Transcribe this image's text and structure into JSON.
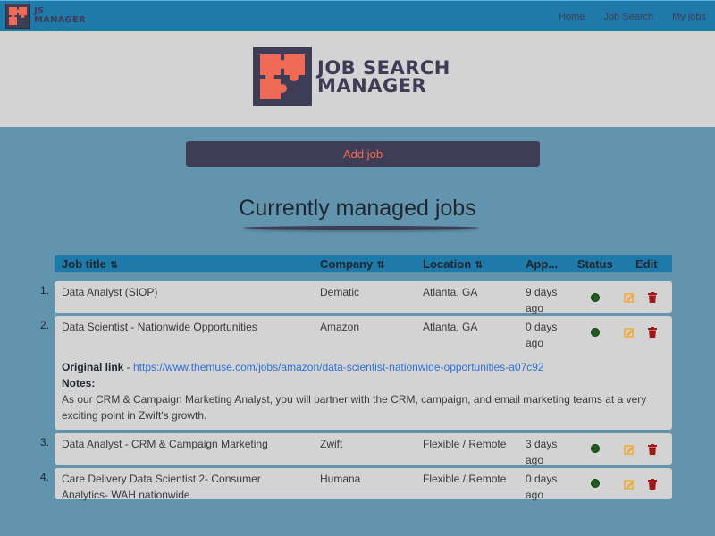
{
  "nav": {
    "brand_line1": "JS",
    "brand_line2": "MANAGER",
    "links": [
      "Home",
      "Job Search",
      "My jobs"
    ]
  },
  "banner": {
    "logo_line1": "JOB SEARCH",
    "logo_line2": "MANAGER"
  },
  "add_job_label": "Add job",
  "section_title": "Currently managed jobs",
  "table": {
    "headers": {
      "title": "Job title",
      "company": "Company",
      "location": "Location",
      "applied": "App...",
      "status": "Status",
      "edit": "Edit"
    },
    "sort_glyph": "⇅",
    "rows": [
      {
        "num": "1.",
        "title": "Data Analyst (SIOP)",
        "company": "Dematic",
        "location": "Atlanta, GA",
        "applied": "9 days ago"
      },
      {
        "num": "2.",
        "title": "Data Scientist - Nationwide Opportunities",
        "company": "Amazon",
        "location": "Atlanta, GA",
        "applied": "0 days ago"
      },
      {
        "num": "3.",
        "title": "Data Analyst - CRM & Campaign Marketing",
        "company": "Zwift",
        "location": "Flexible / Remote",
        "applied": "3 days ago"
      },
      {
        "num": "4.",
        "title": "Care Delivery Data Scientist 2- Consumer Analytics- WAH nationwide",
        "company": "Humana",
        "location": "Flexible / Remote",
        "applied": "0 days ago"
      }
    ],
    "details": {
      "link_label": "Original link",
      "link_sep": " - ",
      "link_url": "https://www.themuse.com/jobs/amazon/data-scientist-nationwide-opportunities-a07c92",
      "notes_label": "Notes:",
      "notes_text": "As our CRM & Campaign Marketing Analyst, you will partner with the CRM, campaign, and email marketing teams at a very exciting point in Zwift's growth."
    }
  },
  "colors": {
    "accent": "#1f7aaa",
    "brand_dark": "#3f3d55",
    "brand_orange": "#f06a55",
    "status_green": "#1e5d1e",
    "edit_orange": "#f5a623",
    "delete_red": "#a01818"
  },
  "icons": [
    "puzzle-logo-icon",
    "status-dot-icon",
    "edit-icon",
    "delete-icon",
    "sort-icon"
  ]
}
